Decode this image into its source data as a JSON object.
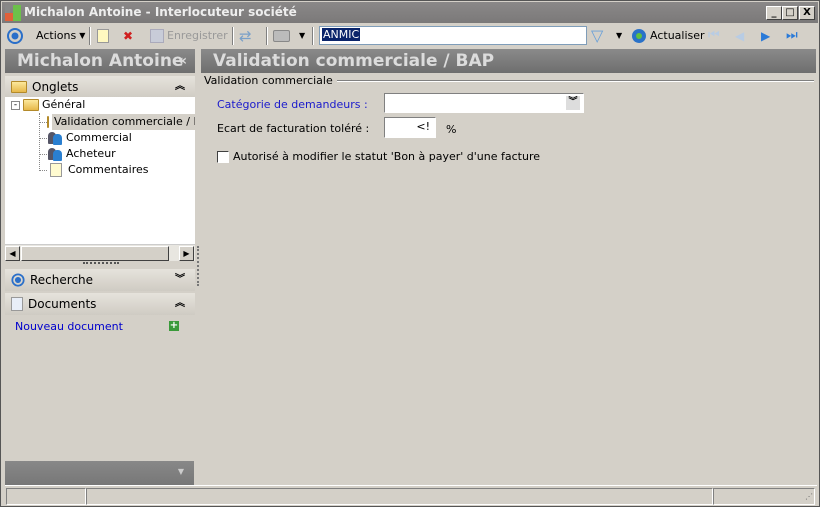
{
  "window": {
    "title": "Michalon Antoine - Interlocuteur société",
    "minimize": "_",
    "maximize": "□",
    "close": "X"
  },
  "toolbar": {
    "actions_label": "Actions",
    "save_label": "Enregistrer",
    "search_value": "ANMIC",
    "refresh_label": "Actualiser"
  },
  "left_panel": {
    "title": "Michalon Antoine",
    "collapse_glyph": "«",
    "onglets": {
      "title": "Onglets",
      "chevron": "⌃"
    },
    "tree": {
      "root": "Général",
      "items": [
        "Validation commerciale / BAP",
        "Commercial",
        "Acheteur",
        "Commentaires"
      ]
    },
    "recherche": {
      "title": "Recherche"
    },
    "documents": {
      "title": "Documents",
      "new_document": "Nouveau document"
    }
  },
  "main": {
    "title": "Validation commerciale / BAP",
    "group_title": "Validation commerciale",
    "fields": {
      "category_label": "Catégorie de demandeurs :",
      "category_value": "",
      "ecart_label": "Ecart de facturation toléré :",
      "ecart_value": "<!",
      "ecart_unit": "%",
      "checkbox_label": "Autorisé à modifier le statut 'Bon à payer' d'une facture"
    }
  },
  "colors": {
    "link": "#0000cc",
    "header_bg": "#7b7b7b",
    "window_bg": "#d4d0c8"
  }
}
